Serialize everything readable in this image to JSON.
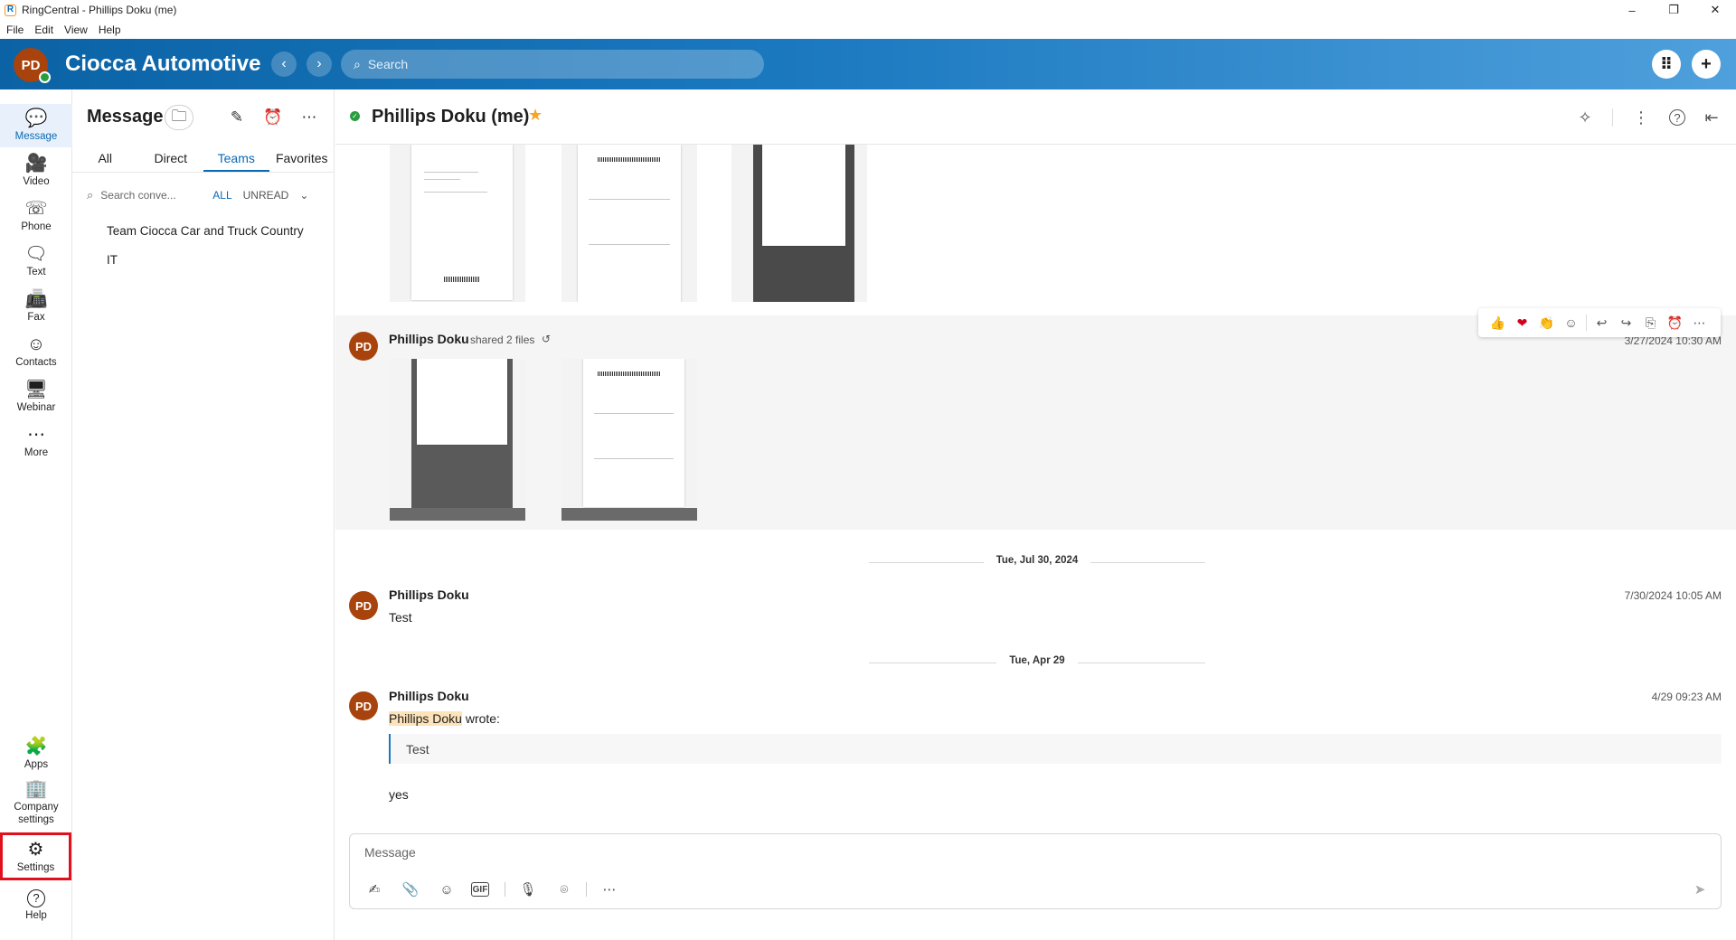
{
  "window": {
    "title": "RingCentral - Phillips Doku (me)",
    "app_logo": "R",
    "controls": [
      "–",
      "❐",
      "✕"
    ]
  },
  "menu": [
    "File",
    "Edit",
    "View",
    "Help"
  ],
  "header": {
    "user_initials": "PD",
    "company_name": "Ciocca Automotive",
    "back_glyph": "‹",
    "forward_glyph": "›",
    "search_placeholder": "Search",
    "dialpad_glyph": "⠿",
    "add_glyph": "+"
  },
  "rail": {
    "items": [
      {
        "label": "Message",
        "icon": "message-icon",
        "glyph": "💬"
      },
      {
        "label": "Video",
        "icon": "video-icon",
        "glyph": "🎥"
      },
      {
        "label": "Phone",
        "icon": "phone-icon",
        "glyph": "☏"
      },
      {
        "label": "Text",
        "icon": "text-icon",
        "glyph": "🗨"
      },
      {
        "label": "Fax",
        "icon": "fax-icon",
        "glyph": "📠"
      },
      {
        "label": "Contacts",
        "icon": "contacts-icon",
        "glyph": "☺"
      },
      {
        "label": "Webinar",
        "icon": "webinar-icon",
        "glyph": "🖥"
      },
      {
        "label": "More",
        "icon": "more-icon",
        "glyph": "⋯"
      }
    ],
    "bottom": [
      {
        "label": "Apps",
        "icon": "apps-icon",
        "glyph": "🧩"
      },
      {
        "label": "Company settings",
        "icon": "company-settings-icon",
        "glyph": "🏢"
      },
      {
        "label": "Settings",
        "icon": "settings-icon",
        "glyph": "⚙"
      },
      {
        "label": "Help",
        "icon": "help-icon",
        "glyph": "?"
      }
    ]
  },
  "conversation_list": {
    "title": "Message",
    "folder_glyph": "🗀",
    "compose_glyph": "✎",
    "reminder_glyph": "⏰",
    "more_glyph": "⋯",
    "tabs": [
      "All",
      "Direct",
      "Teams",
      "Favorites"
    ],
    "active_tab": "Teams",
    "search_placeholder": "Search conve...",
    "filters": [
      "ALL",
      "UNREAD"
    ],
    "filter_dropdown": "⌄",
    "items": [
      "Team Ciocca Car and Truck Country",
      "IT"
    ]
  },
  "conversation": {
    "title": "Phillips Doku (me)",
    "status_glyph": "✓",
    "star_glyph": "★",
    "header_icons": {
      "pin": "✧",
      "more": "⋮",
      "help": "?",
      "collapse": "⇤"
    },
    "posts": [
      {
        "initials": "PD",
        "sender": "Phillips Doku",
        "shared": "shared 2 files",
        "share_glyph": "↺",
        "timestamp": "3/27/2024 10:30 AM"
      },
      {
        "date": "Tue, Jul 30, 2024",
        "initials": "PD",
        "sender": "Phillips Doku",
        "timestamp": "7/30/2024 10:05 AM",
        "text": "Test"
      },
      {
        "date": "Tue, Apr 29",
        "initials": "PD",
        "sender": "Phillips Doku",
        "timestamp": "4/29 09:23 AM",
        "mention": "Phillips Doku",
        "wrote": " wrote:",
        "quote": "Test",
        "text": "yes"
      }
    ],
    "hover_actions": [
      "👍",
      "❤",
      "👏",
      "☺",
      "↩",
      "↪",
      "⎘",
      "⏰",
      "⋯"
    ]
  },
  "composer": {
    "placeholder": "Message",
    "tools": [
      "✍",
      "📎",
      "☺",
      "GIF",
      "🎙",
      "⌾",
      "⋯"
    ],
    "send_glyph": "➤"
  },
  "colors": {
    "brand_blue": "#0a69b4",
    "header_gradient_start": "#0b63a5",
    "avatar": "#a8430d",
    "presence_green": "#2a9e3f",
    "highlight_red": "#e0101c",
    "star": "#f5a623"
  }
}
